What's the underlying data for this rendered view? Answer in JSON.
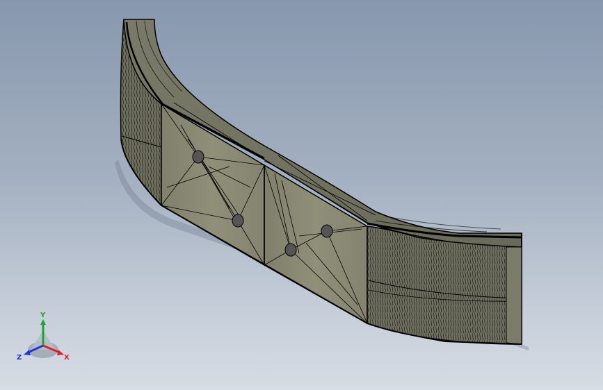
{
  "viewport": {
    "background_top": "#8797ad",
    "background_bottom": "#d6dce4"
  },
  "model": {
    "face_color": "#8a8a76",
    "face_light": "#9a9a86",
    "edge_color": "#000000"
  },
  "triad": {
    "x_label": "X",
    "y_label": "Y",
    "z_label": "Z",
    "x_color": "#e0202a",
    "y_color": "#1aa82a",
    "z_color": "#2236d8"
  }
}
